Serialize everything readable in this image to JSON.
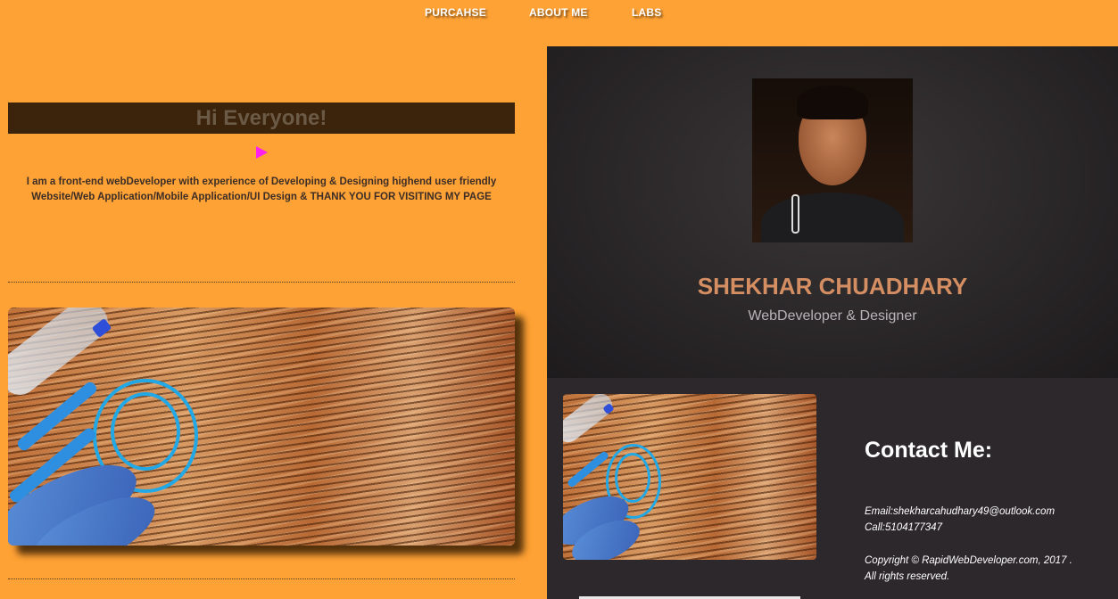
{
  "nav": {
    "items": [
      "PURCAHSE",
      "ABOUT ME",
      "LABS"
    ]
  },
  "hero": {
    "title": "Hi Everyone!",
    "intro_line1": "I am a front-end webDeveloper with experience of Developing & Designing highend user friendly",
    "intro_line2": "Website/Web Application/Mobile Application/UI Design & THANK YOU FOR VISITING MY PAGE"
  },
  "profile": {
    "name": "SHEKHAR CHUADHARY",
    "role": "WebDeveloper & Designer"
  },
  "contact": {
    "title": "Contact Me:",
    "email": "Email:shekharcahudhary49@outlook.com",
    "call": "Call:5104177347",
    "copyright": "Copyright © RapidWebDeveloper.com, 2017 .",
    "rights": "All rights reserved."
  },
  "colors": {
    "background": "#ffa235",
    "accent_name": "#d48e62",
    "panel_dark": "#262325",
    "play_icon": "#ff1ff0"
  },
  "icons": {
    "play": "play-icon"
  }
}
